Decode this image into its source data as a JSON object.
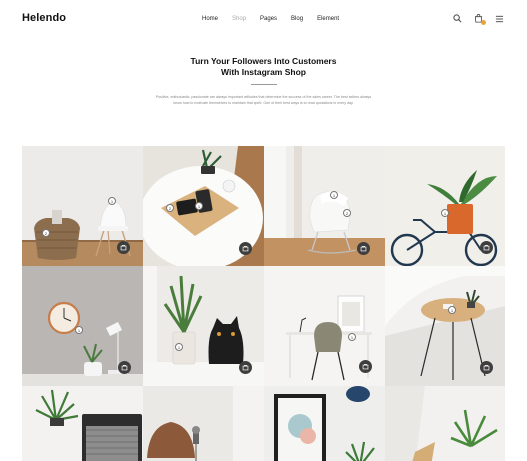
{
  "brand": {
    "name": "Helendo"
  },
  "nav": {
    "items": [
      "Home",
      "Shop",
      "Pages",
      "Blog",
      "Element"
    ],
    "active": "Shop"
  },
  "header_icons": [
    "search-icon",
    "cart-icon",
    "menu-icon"
  ],
  "hero": {
    "title_line1": "Turn Your Followers Into Customers",
    "title_line2": "With Instagram Shop",
    "text": "Positive, enthusiastic, passionate are always important attitudes that determine the success of the sales career. The best sellers always know how to motivate themselves to maintain that spirit. One of their best ways is to read quotations in every day."
  },
  "tiles": [
    {
      "name": "white-chair-basket",
      "hotspots": [
        "1",
        "2"
      ]
    },
    {
      "name": "round-table-tray",
      "hotspots": [
        "1",
        "2"
      ]
    },
    {
      "name": "armchair-window",
      "hotspots": [
        "1",
        "2"
      ]
    },
    {
      "name": "bicycle-plant",
      "hotspots": [
        "1"
      ]
    },
    {
      "name": "wall-clock-lamp",
      "hotspots": [
        "1"
      ]
    },
    {
      "name": "cat-plant",
      "hotspots": [
        "1"
      ]
    },
    {
      "name": "desk-chair",
      "hotspots": [
        "1"
      ]
    },
    {
      "name": "wood-side-table",
      "hotspots": [
        "1"
      ]
    },
    {
      "name": "laptop-plant"
    },
    {
      "name": "brown-chair"
    },
    {
      "name": "framed-poster"
    },
    {
      "name": "plant-corner"
    }
  ],
  "colors": {
    "accent": "#e8a33d",
    "button": "#3e3e3e"
  }
}
